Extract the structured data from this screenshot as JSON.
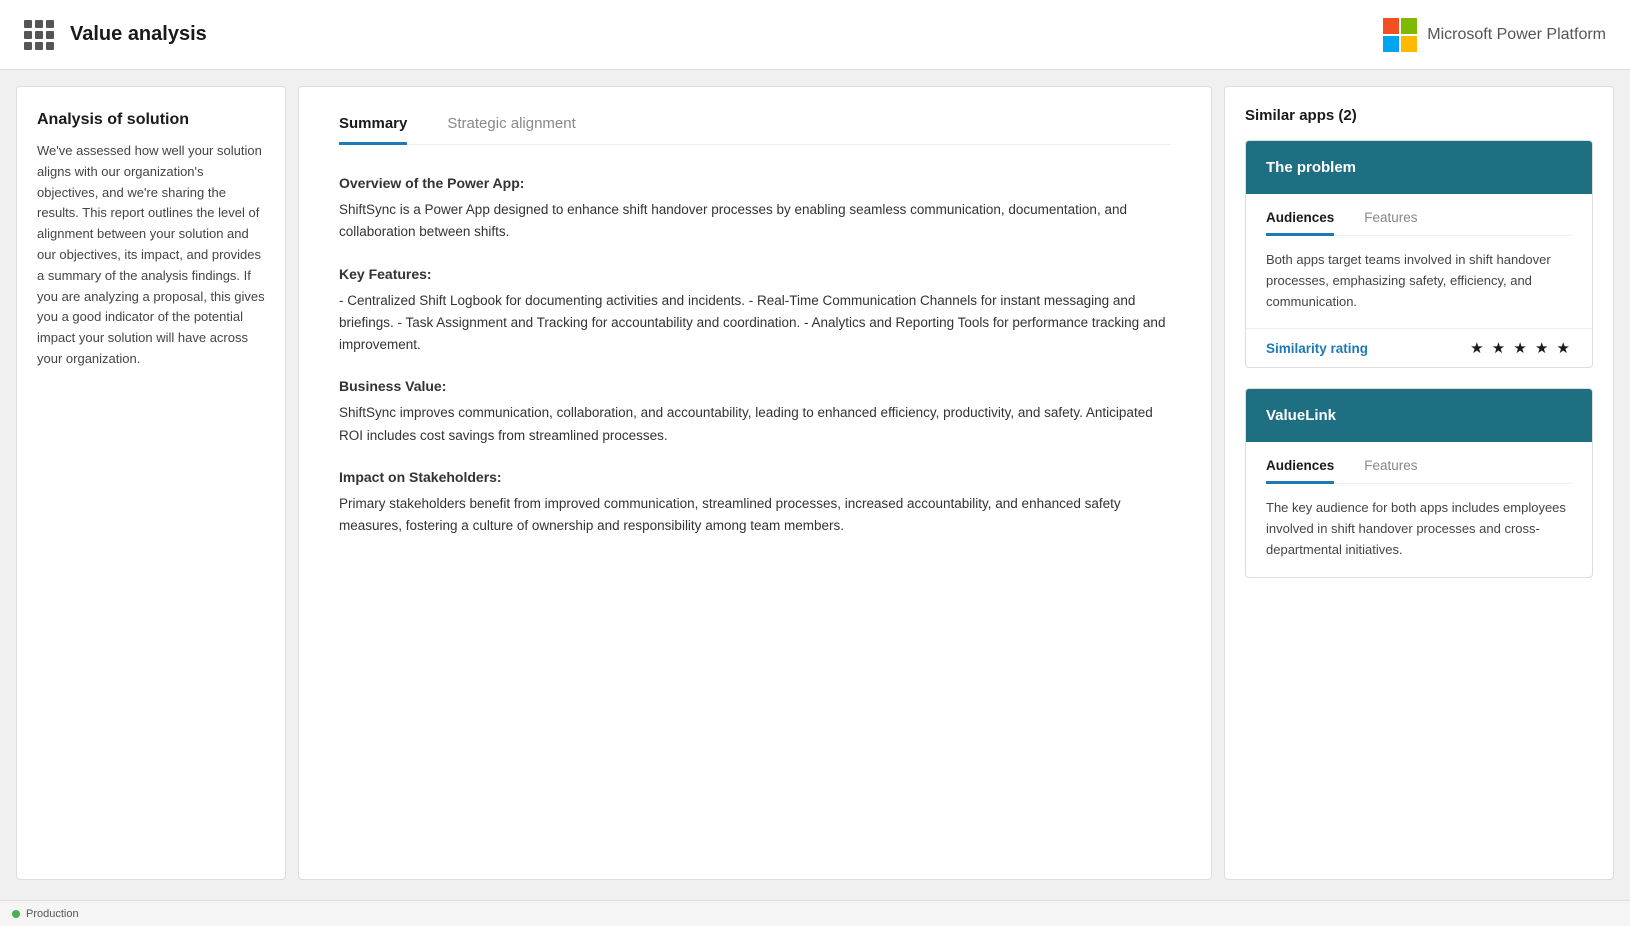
{
  "navbar": {
    "title": "Value analysis",
    "logo_text": "Microsoft Power Platform"
  },
  "left_panel": {
    "title": "Analysis of solution",
    "text": "We've assessed how well your solution aligns with our organization's objectives, and we're sharing the results. This report outlines the level of alignment between your solution and our objectives, its impact, and provides a summary of the analysis findings. If you are analyzing a proposal, this gives you a good indicator of the potential impact your solution will have across your organization."
  },
  "center_panel": {
    "tabs": [
      {
        "label": "Summary",
        "active": true
      },
      {
        "label": "Strategic alignment",
        "active": false
      }
    ],
    "sections": [
      {
        "title": "Overview of the Power App:",
        "text": "ShiftSync is a Power App designed to enhance shift handover processes by enabling seamless communication, documentation, and collaboration between shifts."
      },
      {
        "title": "Key Features:",
        "text": "- Centralized Shift Logbook for documenting activities and incidents. - Real-Time Communication Channels for instant messaging and briefings. - Task Assignment and Tracking for accountability and coordination. - Analytics and Reporting Tools for performance tracking and improvement."
      },
      {
        "title": "Business Value:",
        "text": "ShiftSync improves communication, collaboration, and accountability, leading to enhanced efficiency, productivity, and safety. Anticipated ROI includes cost savings from streamlined processes."
      },
      {
        "title": "Impact on Stakeholders:",
        "text": "Primary stakeholders benefit from improved communication, streamlined processes, increased accountability, and enhanced safety measures, fostering a culture of ownership and responsibility among team members."
      }
    ]
  },
  "right_panel": {
    "title": "Similar apps (2)",
    "apps": [
      {
        "header_title": "The problem",
        "tabs": [
          {
            "label": "Audiences",
            "active": true
          },
          {
            "label": "Features",
            "active": false
          }
        ],
        "text": "Both apps target teams involved in shift handover processes, emphasizing safety, efficiency, and communication.",
        "similarity_label": "Similarity rating",
        "stars": "★ ★ ★ ★ ★"
      },
      {
        "header_title": "ValueLink",
        "tabs": [
          {
            "label": "Audiences",
            "active": true
          },
          {
            "label": "Features",
            "active": false
          }
        ],
        "text": "The key audience for both apps includes employees involved in shift handover processes and cross-departmental initiatives.",
        "similarity_label": "",
        "stars": ""
      }
    ]
  },
  "status_bar": {
    "text": "Production"
  }
}
